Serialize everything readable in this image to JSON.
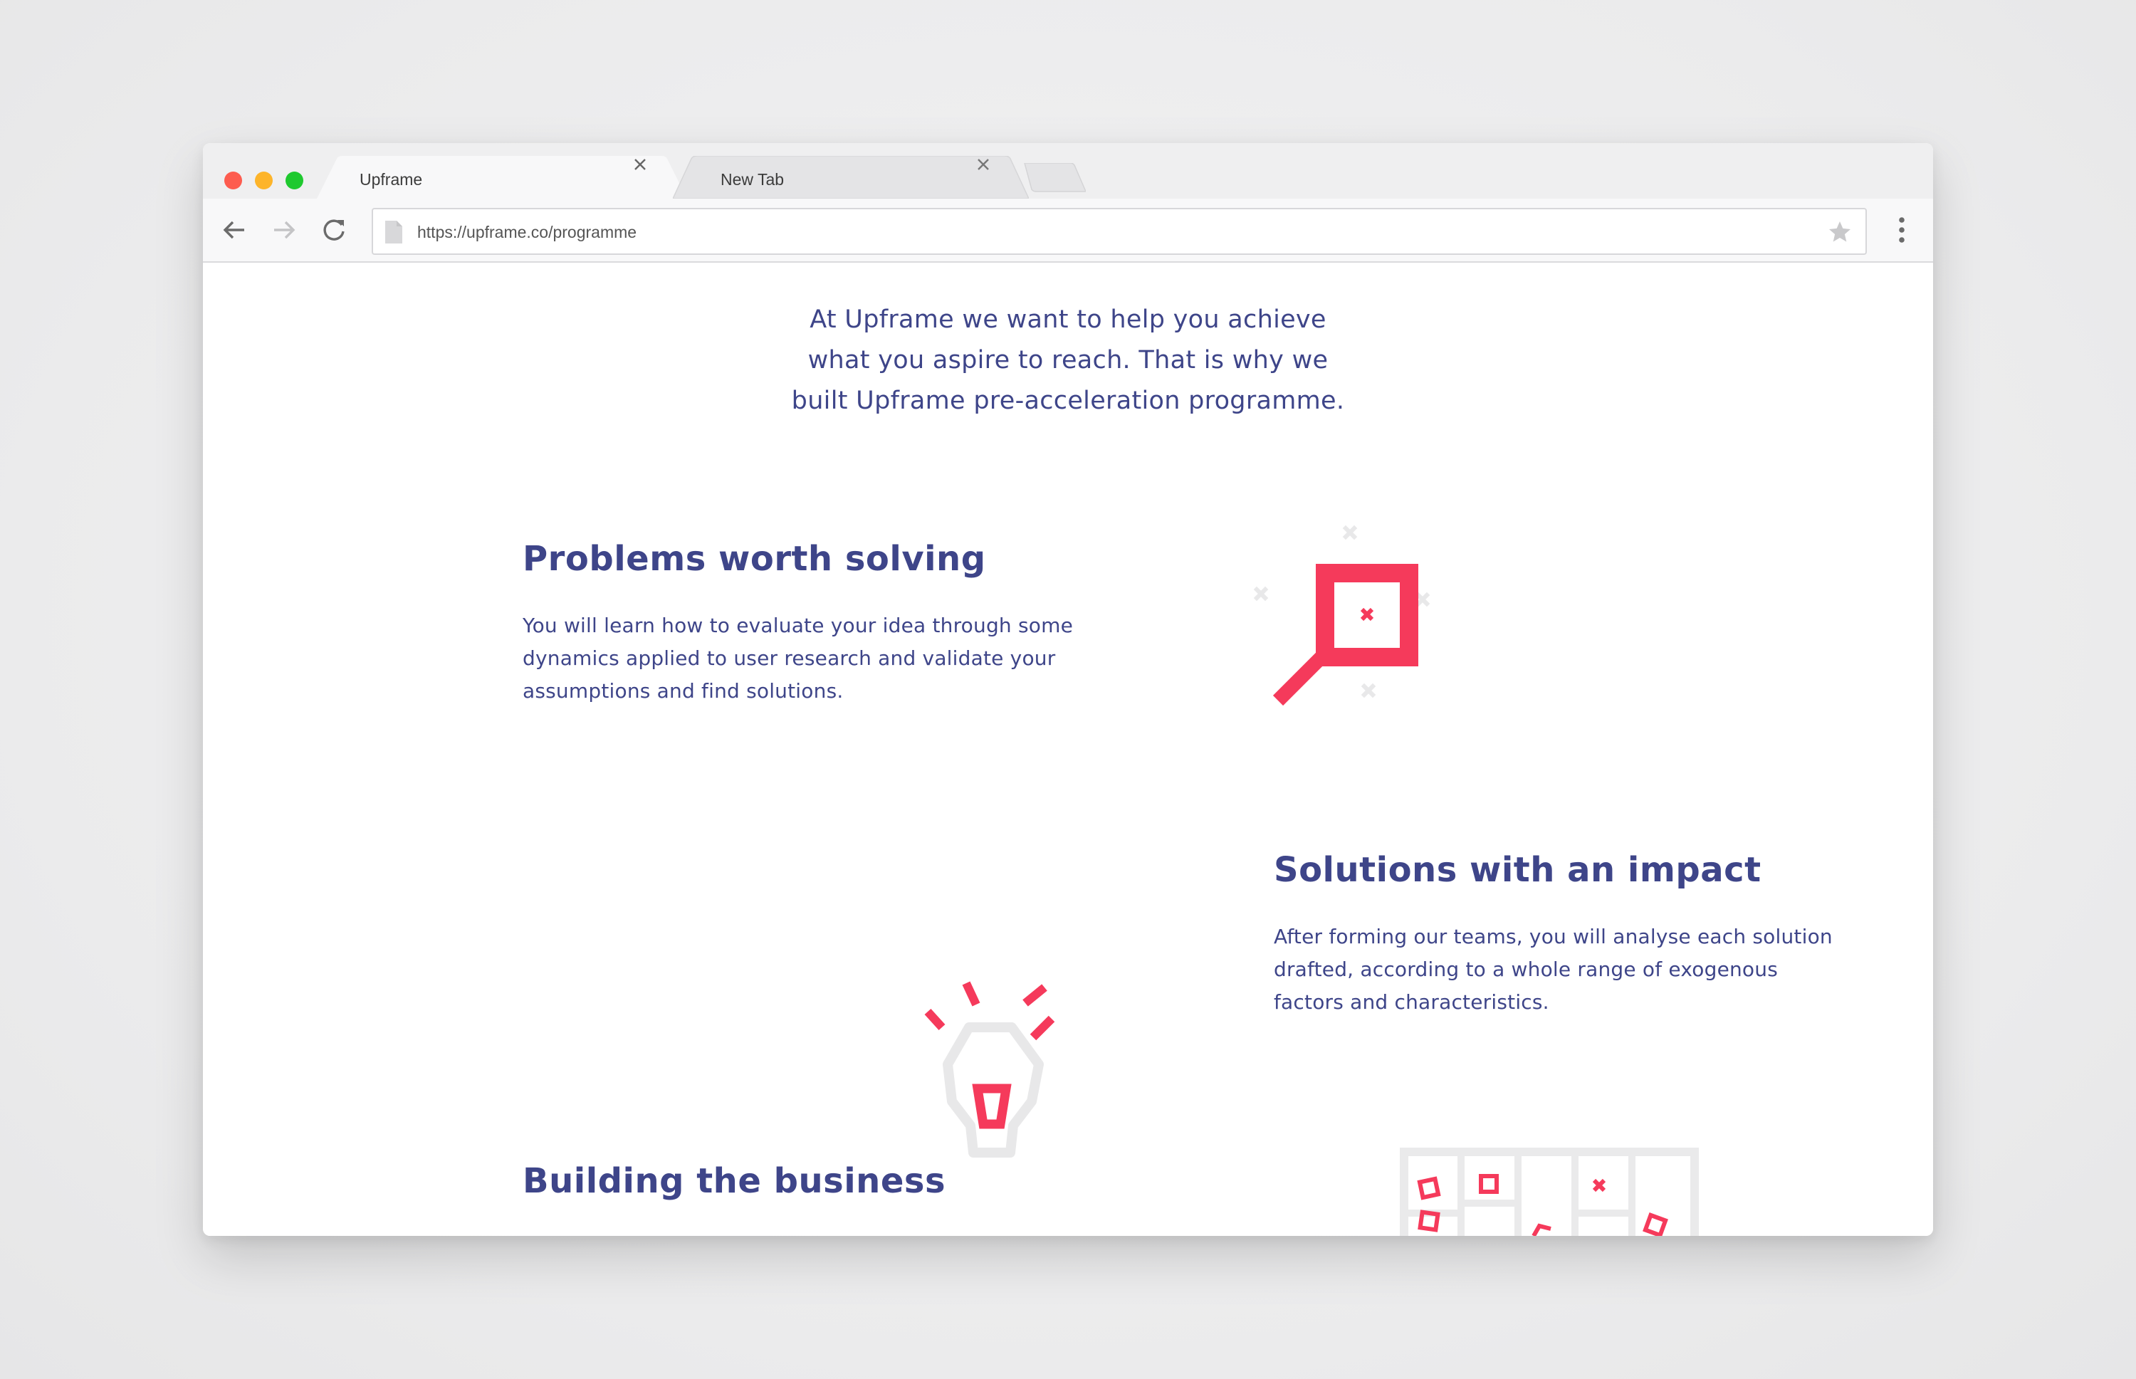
{
  "browser": {
    "tabs": [
      {
        "label": "Upframe",
        "active": true
      },
      {
        "label": "New Tab",
        "active": false
      }
    ],
    "url": "https://upframe.co/programme"
  },
  "page": {
    "intro_lines": [
      "At Upframe we want to help you achieve",
      "what you aspire to reach. That is why we",
      "built Upframe pre-acceleration programme."
    ],
    "sections": [
      {
        "title": "Problems worth solving",
        "body_lines": [
          "You will learn how to evaluate your idea through some",
          "dynamics applied to user research and validate your",
          "assumptions and find solutions."
        ],
        "icon": "magnifier-icon"
      },
      {
        "title": "Solutions with an impact",
        "body_lines": [
          "After forming our teams, you will analyse each solution",
          "drafted, according to a whole range of exogenous",
          "factors and characteristics."
        ],
        "icon": "lightbulb-icon"
      },
      {
        "title": "Building the business",
        "icon": "board-icon"
      }
    ]
  },
  "colors": {
    "brand_navy": "#3e4589",
    "accent_red": "#f53a5b",
    "icon_gray": "#e8e8e9"
  }
}
